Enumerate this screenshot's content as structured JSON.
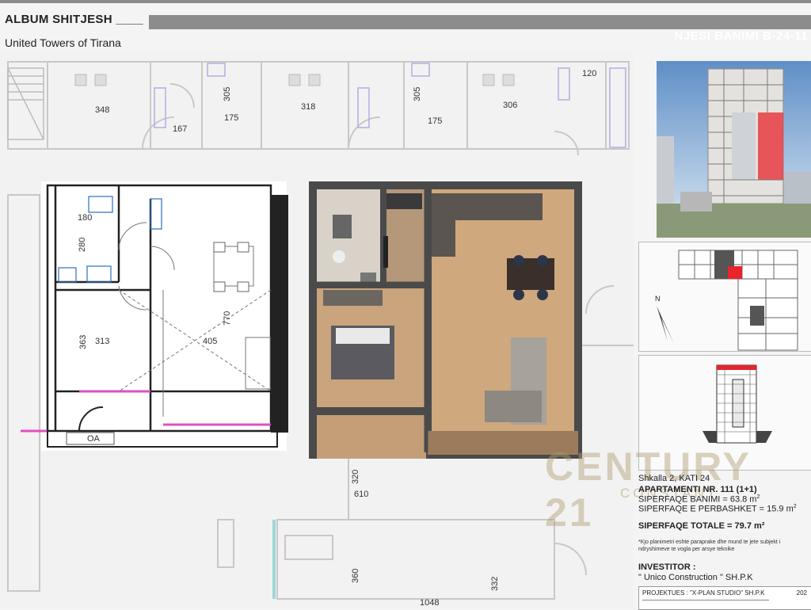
{
  "header": {
    "title": "ALBUM SHITJESH ____",
    "subtitle": "United  Towers of Tirana",
    "unit_code": "NJESI BANIMI B-24-11"
  },
  "plan": {
    "dims": {
      "d348": "348",
      "d305a": "305",
      "d318": "318",
      "d305b": "305",
      "d306": "306",
      "d120": "120",
      "d167": "167",
      "d175a": "175",
      "d175b": "175",
      "d180": "180",
      "d280": "280",
      "d770": "770",
      "d363": "363",
      "d313": "313",
      "d405": "405",
      "d320": "320",
      "d610": "610",
      "d360": "360",
      "d332": "332",
      "d1048": "1048",
      "oa": "OA"
    }
  },
  "info": {
    "stair": "Shkalla 2, KATI 24",
    "apartment": "APARTAMENTI NR. 111 (1+1)",
    "area_living": "SIPERFAQE BANIMI = 63.8  m",
    "area_shared": "SIPERFAQE E PERBASHKET = 15.9 m",
    "area_total": "SIPERFAQE TOTALE = 79.7 m²",
    "note": "*Kjo planimetri eshte paraprake dhe mund te jete subjekt i ndryshimeve te vogla per arsye teknike",
    "investor_label": "INVESTITOR :",
    "investor": "\" Unico Construction \" SH.P.K",
    "designer": "PROJEKTUES : \"X-PLAN STUDIO\" SH.P.K",
    "year": "202",
    "north": "N"
  },
  "watermark": {
    "brand": "CENTURY 21",
    "tagline": "CONSTANT"
  },
  "colors": {
    "accent_red": "#e8242c",
    "header_bar": "#8c8c8c",
    "wall_dark": "#4a4a4a",
    "floor_wood": "#c9a47c",
    "balcony_pink": "#e050c0"
  }
}
